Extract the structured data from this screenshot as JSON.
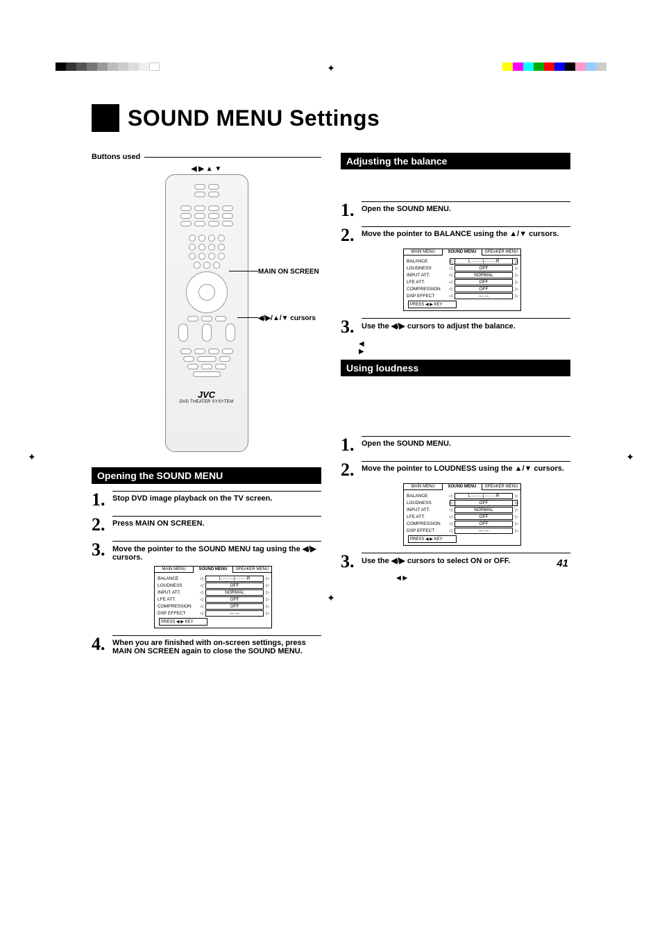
{
  "page_number": "41",
  "title": "SOUND MENU Settings",
  "buttons_used_label": "Buttons used",
  "remote": {
    "cursor_arrows": "◀ ▶ ▲ ▼",
    "main_on_screen_label": "MAIN ON SCREEN",
    "cursors_label": "◀/▶/▲/▼ cursors",
    "brand": "JVC",
    "subtitle": "DVD THEATER SYSYTEM"
  },
  "sections": {
    "opening": {
      "title": "Opening the SOUND MENU",
      "steps": [
        {
          "n": "1.",
          "text": "Stop DVD image playback on the TV screen."
        },
        {
          "n": "2.",
          "text": "Press MAIN ON SCREEN."
        },
        {
          "n": "3.",
          "text": "Move the pointer to the SOUND MENU tag using the ◀/▶ cursors."
        },
        {
          "n": "4.",
          "text": "When you are finished with on-screen settings, press MAIN ON SCREEN again to close the SOUND MENU."
        }
      ]
    },
    "balance": {
      "title": "Adjusting the balance",
      "steps": [
        {
          "n": "1.",
          "text": "Open the SOUND MENU."
        },
        {
          "n": "2.",
          "text": "Move the pointer to BALANCE using the ▲/▼ cursors."
        },
        {
          "n": "3.",
          "text": "Use the ◀/▶ cursors to adjust the balance.",
          "arrows": "◀\n▶"
        }
      ]
    },
    "loudness": {
      "title": "Using loudness",
      "steps": [
        {
          "n": "1.",
          "text": "Open the SOUND MENU."
        },
        {
          "n": "2.",
          "text": "Move the pointer to LOUDNESS using the ▲/▼ cursors."
        },
        {
          "n": "3.",
          "text": "Use the ◀/▶ cursors to select ON or OFF.",
          "arrows": "◀ ▶"
        }
      ]
    }
  },
  "menu_fig": {
    "tabs": {
      "main": "MAIN MENU",
      "sound": "SOUND MENU",
      "speaker": "SPEAKER MENU"
    },
    "rows": {
      "balance": {
        "label": "BALANCE",
        "value": "L ··········|·········· R"
      },
      "loudness": {
        "label": "LOUDNESS",
        "value": "OFF"
      },
      "input_att": {
        "label": "INPUT ATT.",
        "value": "NORMAL"
      },
      "lfe_att": {
        "label": "LFE ATT.",
        "value": "OFF"
      },
      "compression": {
        "label": "COMPRESSION",
        "value": "OFF"
      },
      "dsp_effect": {
        "label": "DSP EFFECT",
        "value": "— —"
      }
    },
    "footer": "PRESS ◀ ▶ KEY"
  }
}
